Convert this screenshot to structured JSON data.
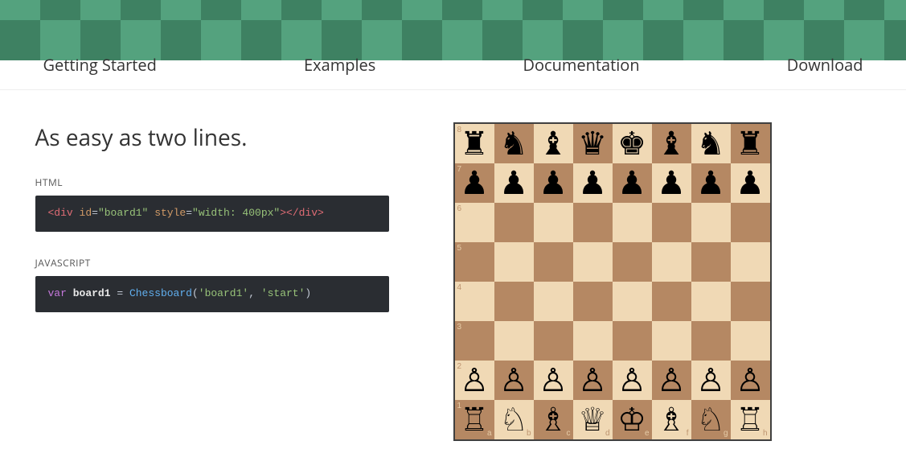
{
  "nav": {
    "getting_started": "Getting Started",
    "examples": "Examples",
    "documentation": "Documentation",
    "download": "Download"
  },
  "headline": "As easy as two lines.",
  "code_blocks": {
    "html_label": "HTML",
    "js_label": "JAVASCRIPT",
    "html_code": {
      "open_tag": "<div",
      "attr_id_name": "id",
      "attr_id_val": "\"board1\"",
      "attr_style_name": "style",
      "attr_style_val": "\"width: 400px\"",
      "close_empty": "></div>"
    },
    "js_code": {
      "kw_var": "var",
      "ident": "board1",
      "eq": " = ",
      "fn": "Chessboard",
      "paren_open": "(",
      "arg1": "'board1'",
      "comma": ", ",
      "arg2": "'start'",
      "paren_close": ")"
    }
  },
  "board": {
    "ranks": [
      "8",
      "7",
      "6",
      "5",
      "4",
      "3",
      "2",
      "1"
    ],
    "files": [
      "a",
      "b",
      "c",
      "d",
      "e",
      "f",
      "g",
      "h"
    ],
    "position": [
      [
        "bR",
        "bN",
        "bB",
        "bQ",
        "bK",
        "bB",
        "bN",
        "bR"
      ],
      [
        "bP",
        "bP",
        "bP",
        "bP",
        "bP",
        "bP",
        "bP",
        "bP"
      ],
      [
        "",
        "",
        "",
        "",
        "",
        "",
        "",
        ""
      ],
      [
        "",
        "",
        "",
        "",
        "",
        "",
        "",
        ""
      ],
      [
        "",
        "",
        "",
        "",
        "",
        "",
        "",
        ""
      ],
      [
        "",
        "",
        "",
        "",
        "",
        "",
        "",
        ""
      ],
      [
        "wP",
        "wP",
        "wP",
        "wP",
        "wP",
        "wP",
        "wP",
        "wP"
      ],
      [
        "wR",
        "wN",
        "wB",
        "wQ",
        "wK",
        "wB",
        "wN",
        "wR"
      ]
    ],
    "piece_glyphs": {
      "bK": "♚",
      "bQ": "♛",
      "bR": "♜",
      "bB": "♝",
      "bN": "♞",
      "bP": "♟",
      "wK": "♔",
      "wQ": "♕",
      "wR": "♖",
      "wB": "♗",
      "wN": "♘",
      "wP": "♙"
    }
  },
  "colors": {
    "strip_light": "#54a27e",
    "strip_dark": "#3e8162",
    "board_light": "#f0d9b5",
    "board_dark": "#b58863"
  }
}
